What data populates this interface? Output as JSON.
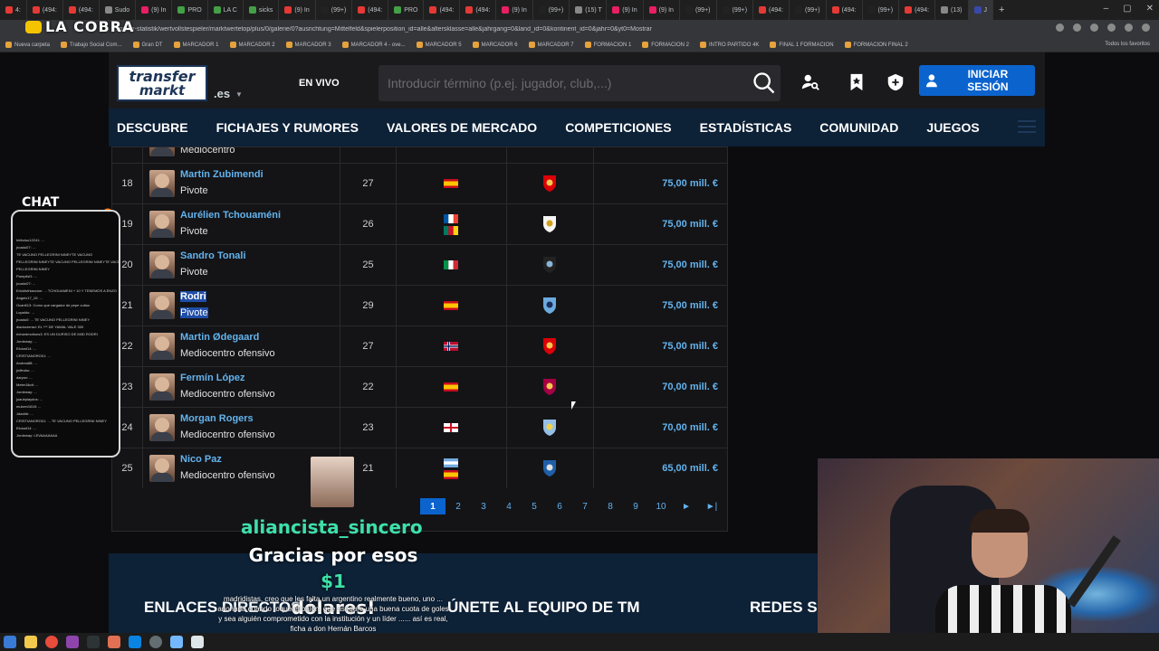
{
  "overlay_logo": "LA COBRA",
  "browser": {
    "tabs": [
      "4:",
      "(494:",
      "(494:",
      "Sudo",
      "(9) In",
      "PRO",
      "LA C",
      "sicks",
      "(9) In",
      "(99+)",
      "(494:",
      "PRO",
      "(494:",
      "(494:",
      "(9) In",
      "(99+)",
      "(15) T",
      "(9) In",
      "(9) In",
      "(99+)",
      "(99+)",
      "(494:",
      "(99+)",
      "(494:",
      "(99+)",
      "(494:",
      "(13)",
      "J"
    ],
    "url": "spieler-statistik/wertvollstespieler/marktwertetop/plus/0/galerie/0?ausrichtung=Mittelfeld&spielerposition_id=alle&altersklasse=alle&jahrgang=0&land_id=0&kontinent_id=0&jahr=0&yt0=Mostrar",
    "bookmarks": [
      "Nueva carpeta",
      "Trabajo Social Com...",
      "Gran DT",
      "MARCADOR 1",
      "MARCADOR 2",
      "MARCADOR 3",
      "MARCADOR 4 - ove...",
      "MARCADOR 5",
      "MARCADOR 6",
      "MARCADOR 7",
      "FORMACION 1",
      "FORMACION 2",
      "INTRO PARTIDO 4K",
      "FINAL 1 FORMACION",
      "FORMACION FINAL 2"
    ],
    "bookmarks_right": "Todos los favoritos"
  },
  "header": {
    "logo_line1": "transfer",
    "logo_line2": "markt",
    "domain": ".es",
    "live_label": "EN VIVO",
    "search_placeholder": "Introducir término (p.ej. jugador, club,...)",
    "login_label": "INICIAR SESIÓN"
  },
  "nav": [
    "DESCUBRE",
    "FICHAJES Y RUMORES",
    "VALORES DE MERCADO",
    "COMPETICIONES",
    "ESTADÍSTICAS",
    "COMUNIDAD",
    "JUEGOS"
  ],
  "table": {
    "partial_row_position": "Mediocentro",
    "rows": [
      {
        "num": "18",
        "name": "Martín Zubimendi",
        "position": "Pivote",
        "age": "27",
        "flags": [
          "spain"
        ],
        "club": "arsenal-crest",
        "value": "75,00 mill. €"
      },
      {
        "num": "19",
        "name": "Aurélien Tchouaméni",
        "position": "Pivote",
        "age": "26",
        "flags": [
          "france",
          "cameroon"
        ],
        "club": "real-madrid-crest",
        "value": "75,00 mill. €"
      },
      {
        "num": "20",
        "name": "Sandro Tonali",
        "position": "Pivote",
        "age": "25",
        "flags": [
          "italy"
        ],
        "club": "newcastle-crest",
        "value": "75,00 mill. €"
      },
      {
        "num": "21",
        "name": "Rodri",
        "position": "Pivote",
        "age": "29",
        "flags": [
          "spain"
        ],
        "club": "man-city-crest",
        "value": "75,00 mill. €",
        "highlighted": true
      },
      {
        "num": "22",
        "name": "Martin Ødegaard",
        "position": "Mediocentro ofensivo",
        "age": "27",
        "flags": [
          "norway"
        ],
        "club": "arsenal-crest",
        "value": "75,00 mill. €"
      },
      {
        "num": "23",
        "name": "Fermín López",
        "position": "Mediocentro ofensivo",
        "age": "22",
        "flags": [
          "spain"
        ],
        "club": "barcelona-crest",
        "value": "70,00 mill. €"
      },
      {
        "num": "24",
        "name": "Morgan Rogers",
        "position": "Mediocentro ofensivo",
        "age": "23",
        "flags": [
          "england"
        ],
        "club": "aston-villa-crest",
        "value": "70,00 mill. €"
      },
      {
        "num": "25",
        "name": "Nico Paz",
        "position": "Mediocentro ofensivo",
        "age": "21",
        "flags": [
          "argentina",
          "spain"
        ],
        "club": "como-crest",
        "value": "65,00 mill. €"
      }
    ],
    "pagination": [
      "1",
      "2",
      "3",
      "4",
      "5",
      "6",
      "7",
      "8",
      "9",
      "10",
      "►",
      "►|"
    ]
  },
  "footer": {
    "links_title": "ENLACES DIRECTOS",
    "team_title": "ÚNETE AL EQUIPO DE TM",
    "social_title": "REDES SO"
  },
  "stream": {
    "chat_title": "CHAT",
    "donor_name": "aliancista_sincero",
    "thanks_prefix": "Gracias por esos ",
    "amount": "$1",
    "thanks_suffix": "dólares!",
    "message": "madridistas, creo que les falta un argentino realmente bueno, uno ... anonada cuando toque el balón, que asegure una buena cuota de goles y sea alguién comprometido con la institución y un líder ...... así es real, ficha a don Hernán Barcos",
    "chat_lines": [
      "hiribdou12241: ...",
      "jroadu07: ...",
      "TE VACUNO PELLEGRINI NINEYTE VACUNO",
      "PELLEGRINI NINEYTE VACUNO PELLEGRINI NINEYTE VACUNO",
      "PELLEGRINI NINEY",
      "Pamplisf1: ...",
      "jroadu07: ...",
      "Erickfuthlancion: ... TCHOUAMENI + 10 Y TENEMOS A ENZO",
      "Angelz17_10: ...",
      "Ocan613: Como que cargador de pepe culiao",
      "Lopaldo: ...",
      "jroadu0: ... TE VACUNO PELLEGRINI NINEY",
      "diadocerraci: EL *** DE YAMAL VALE 300",
      "richardmotions3: ES UN DURISO DE MIID RODRI",
      "Jordeway: ...",
      "Eloiosf14: ...",
      "CRISTIANORO01: ...",
      "Andrea88: ...",
      "jrdfeoks: ...",
      "daryox: ...",
      "Meter1lkdt: ...",
      "Jordeway: ...",
      "juaubplaydos: ...",
      "mulzen1618: ...",
      "Jdadrib: ...",
      "CRISTIANORO01: ... TE VACUNO PELLEGRINI NINEY",
      "Eloiosf14: ...",
      "Jordeway: LEVAAAAAAA"
    ]
  },
  "colors": {
    "link_blue": "#63b3ed",
    "nav_bg": "#0d2137",
    "accent_button": "#0b63ce",
    "donor_green": "#3ee0a8",
    "highlight": "#1f4ea8"
  }
}
